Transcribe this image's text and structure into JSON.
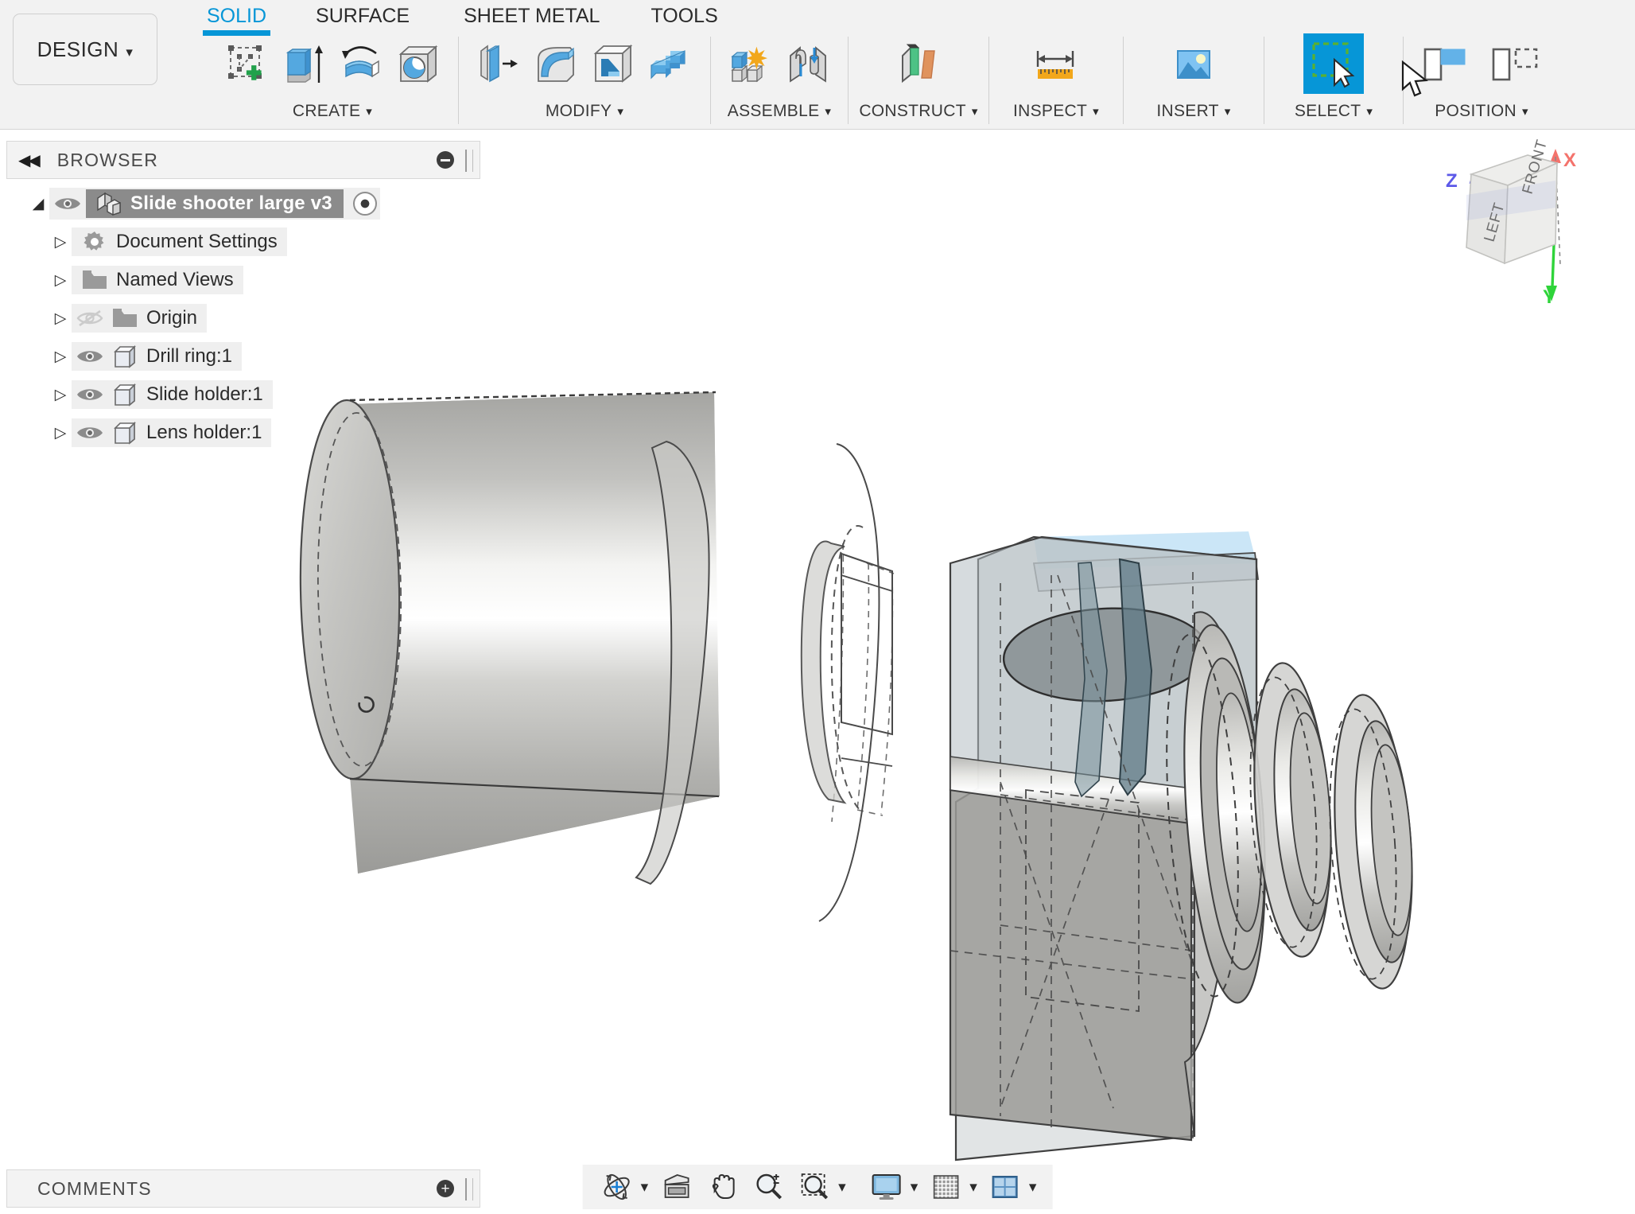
{
  "app": {
    "workspace_button": "DESIGN",
    "caret": "▾"
  },
  "tabs": [
    {
      "label": "SOLID",
      "active": true
    },
    {
      "label": "SURFACE",
      "active": false
    },
    {
      "label": "SHEET METAL",
      "active": false
    },
    {
      "label": "TOOLS",
      "active": false
    }
  ],
  "panels": [
    {
      "name": "CREATE",
      "icons": [
        {
          "name": "create-sketch-icon",
          "label": "Create Sketch"
        },
        {
          "name": "extrude-icon",
          "label": "Extrude"
        },
        {
          "name": "revolve-icon",
          "label": "Revolve"
        },
        {
          "name": "hole-icon",
          "label": "Hole"
        }
      ]
    },
    {
      "name": "MODIFY",
      "icons": [
        {
          "name": "press-pull-icon",
          "label": "Press Pull"
        },
        {
          "name": "fillet-icon",
          "label": "Fillet"
        },
        {
          "name": "shell-icon",
          "label": "Shell"
        },
        {
          "name": "combine-icon",
          "label": "Combine"
        }
      ]
    },
    {
      "name": "ASSEMBLE",
      "icons": [
        {
          "name": "new-component-icon",
          "label": "New Component"
        },
        {
          "name": "joint-icon",
          "label": "Joint"
        }
      ]
    },
    {
      "name": "CONSTRUCT",
      "icons": [
        {
          "name": "offset-plane-icon",
          "label": "Offset Plane"
        }
      ]
    },
    {
      "name": "INSPECT",
      "icons": [
        {
          "name": "measure-icon",
          "label": "Measure"
        }
      ]
    },
    {
      "name": "INSERT",
      "icons": [
        {
          "name": "insert-image-icon",
          "label": "Canvas"
        }
      ]
    },
    {
      "name": "SELECT",
      "icons": [
        {
          "name": "select-window-icon",
          "label": "Select",
          "selected": true
        }
      ]
    },
    {
      "name": "POSITION",
      "icons": [
        {
          "name": "align-icon",
          "label": "Align"
        },
        {
          "name": "move-copy-icon",
          "label": "Move/Copy"
        }
      ]
    }
  ],
  "browser": {
    "title": "BROWSER",
    "collapse_glyph": "◀◀",
    "minimize_label": "−",
    "tree": [
      {
        "label": "Slide shooter large v3",
        "icon": "component-icon",
        "visibility": "visible",
        "expanded": true,
        "root": true,
        "indent": 0
      },
      {
        "label": "Document Settings",
        "icon": "gear-icon",
        "visibility": "none",
        "expanded": false,
        "indent": 1
      },
      {
        "label": "Named Views",
        "icon": "folder-icon",
        "visibility": "none",
        "expanded": false,
        "indent": 1
      },
      {
        "label": "Origin",
        "icon": "folder-icon",
        "visibility": "hidden",
        "expanded": false,
        "indent": 1
      },
      {
        "label": "Drill ring:1",
        "icon": "body-icon",
        "visibility": "visible",
        "expanded": false,
        "indent": 1
      },
      {
        "label": "Slide holder:1",
        "icon": "body-icon",
        "visibility": "visible",
        "expanded": false,
        "indent": 1
      },
      {
        "label": "Lens holder:1",
        "icon": "body-icon",
        "visibility": "visible",
        "expanded": false,
        "indent": 1
      }
    ]
  },
  "comments": {
    "title": "COMMENTS",
    "add_glyph": "+"
  },
  "navbar": [
    {
      "name": "orbit-icon",
      "label": "Orbit",
      "caret": true
    },
    {
      "name": "look-at-icon",
      "label": "Look At",
      "caret": false
    },
    {
      "name": "pan-icon",
      "label": "Pan",
      "caret": false
    },
    {
      "name": "zoom-icon",
      "label": "Zoom",
      "caret": false
    },
    {
      "name": "zoom-window-icon",
      "label": "Fit",
      "caret": true
    },
    {
      "name": "display-settings-icon",
      "label": "Display Settings",
      "caret": true
    },
    {
      "name": "grid-snap-icon",
      "label": "Grid and Snaps",
      "caret": true
    },
    {
      "name": "viewports-icon",
      "label": "Viewports",
      "caret": true
    }
  ],
  "viewcube": {
    "faces": {
      "front": "FRONT",
      "left": "LEFT"
    },
    "axes": [
      {
        "label": "X",
        "color": "#f4736c"
      },
      {
        "label": "Y",
        "color": "#2fd43a"
      },
      {
        "label": "Z",
        "color": "#5c59e8"
      }
    ]
  },
  "colors": {
    "accent": "#0696d7",
    "toolbar_bg": "#f2f2f2",
    "canvas_bg": "#ffffff",
    "selection_highlight": "#8b8b8b"
  },
  "model": {
    "parts": [
      "Drill ring",
      "Slide holder",
      "Lens holder"
    ],
    "description": "Exploded assembly view of a cylindrical drill ring, a transparent slide holder block with elliptical bore, and two lens holder rings"
  }
}
